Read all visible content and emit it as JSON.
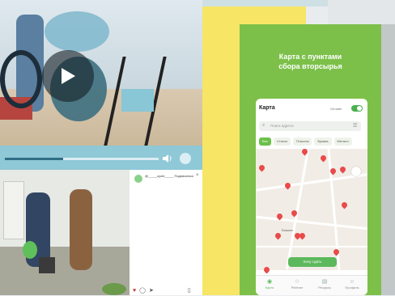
{
  "video": {
    "progress": 0.38,
    "play_icon": "play-icon",
    "volume_icon": "volume-icon"
  },
  "instagram": {
    "username": "@_____cycle_____ Подписаться",
    "close": "×",
    "caption": "",
    "icons": [
      "heart-icon",
      "comment-icon",
      "share-icon",
      "bookmark-icon"
    ],
    "likes": ""
  },
  "poster": {
    "title_line1": "Карта с пунктами",
    "title_line2": "сбора вторсырья"
  },
  "app": {
    "screen_title": "Карта",
    "toggle_label": "Онлайн",
    "search_placeholder": "Поиск адреса",
    "filters": [
      "Все",
      "Стекло",
      "Пластик",
      "Бумага",
      "Металл"
    ],
    "map_label": "Бишкек",
    "map_button": "Хочу сдать",
    "tabs": [
      "Карта",
      "Рейтинг",
      "Ресурсы",
      "Профиль"
    ],
    "accent": "#5cb85c",
    "pin_color": "#e94a4a"
  }
}
